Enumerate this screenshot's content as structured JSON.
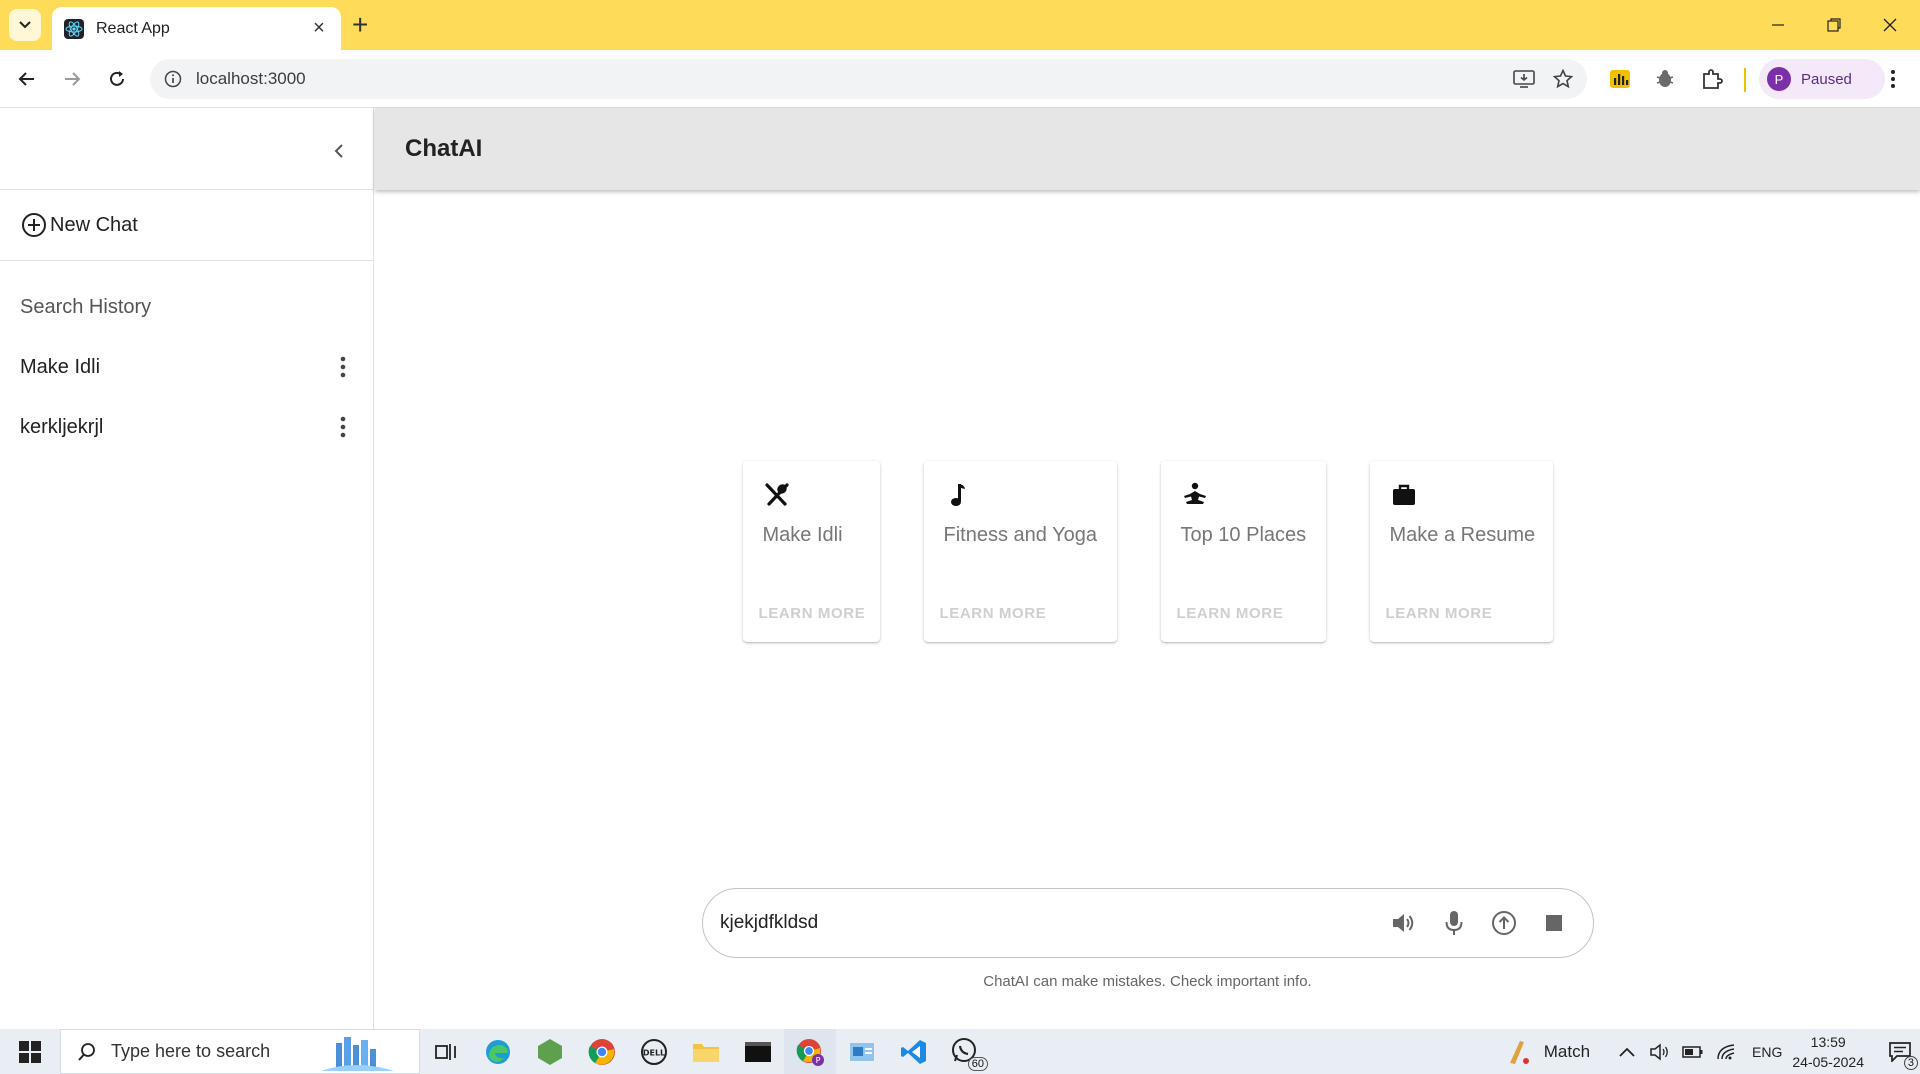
{
  "browser": {
    "tab_title": "React App",
    "url": "localhost:3000",
    "profile_initial": "P",
    "profile_status": "Paused"
  },
  "sidebar": {
    "new_chat_label": "New Chat",
    "search_history_label": "Search History",
    "history": [
      {
        "label": "Make Idli"
      },
      {
        "label": "kerkljekrjl"
      }
    ]
  },
  "header": {
    "title": "ChatAI"
  },
  "cards": [
    {
      "icon": "cutlery-icon",
      "label": "Make Idli",
      "button": "LEARN MORE"
    },
    {
      "icon": "music-note-icon",
      "label": "Fitness and Yoga",
      "button": "LEARN MORE"
    },
    {
      "icon": "meditation-icon",
      "label": "Top 10 Places",
      "button": "LEARN MORE"
    },
    {
      "icon": "briefcase-icon",
      "label": "Make a Resume",
      "button": "LEARN MORE"
    }
  ],
  "composer": {
    "value": "kjekjdfkldsd",
    "disclaimer": "ChatAI can make mistakes. Check important info."
  },
  "taskbar": {
    "search_placeholder": "Type here to search",
    "whatsapp_badge": "60",
    "weather_label": "Match",
    "language": "ENG",
    "time": "13:59",
    "date": "24-05-2024",
    "notification_count": "3"
  },
  "colors": {
    "tabbar": "#fedc5a",
    "appbar": "#e6e6e6"
  }
}
